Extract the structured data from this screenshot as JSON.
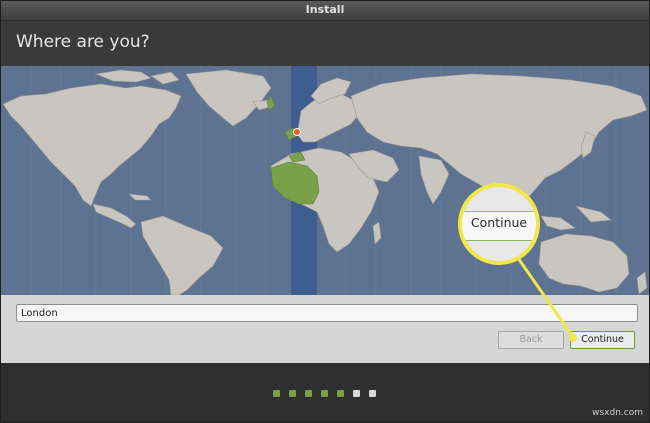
{
  "window": {
    "title": "Install"
  },
  "header": {
    "heading": "Where are you?"
  },
  "location": {
    "value": "London",
    "placeholder": ""
  },
  "buttons": {
    "back_label": "Back",
    "continue_label": "Continue"
  },
  "callout": {
    "magnified_label": "Continue"
  },
  "progress": {
    "total_steps": 7,
    "completed_steps": 5
  },
  "watermark": {
    "text": "wsxdn.com"
  },
  "colors": {
    "ocean": "#5e7391",
    "land": "#c9c5c0",
    "selected_region": "#7aa04a",
    "timezone_band": "#3f5d8e",
    "callout": "#f1e64a"
  },
  "icons": {
    "selected_city_marker": "pin-icon"
  }
}
